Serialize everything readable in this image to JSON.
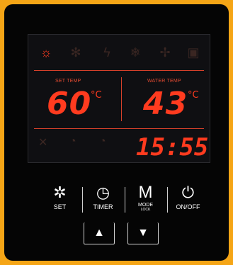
{
  "display": {
    "set_temp": {
      "label": "SET TEMP",
      "value": "60",
      "unit": "°C"
    },
    "water_temp": {
      "label": "WATER TEMP",
      "value": "43",
      "unit": "°C"
    },
    "clock": "15:55",
    "status_icons": {
      "active_color": "#ff3b1f",
      "dim_color": "#3a2622",
      "icons": [
        "sun-icon",
        "defrost-icon",
        "lightning-icon",
        "snowflake-icon",
        "fan-icon",
        "lock-icon"
      ]
    }
  },
  "buttons": {
    "set": "SET",
    "timer": "TIMER",
    "mode": "M",
    "mode_label": "MODE",
    "mode_sub": "LOCK",
    "onoff": "ON/OFF"
  },
  "arrows": {
    "up": "▲",
    "down": "▼"
  }
}
